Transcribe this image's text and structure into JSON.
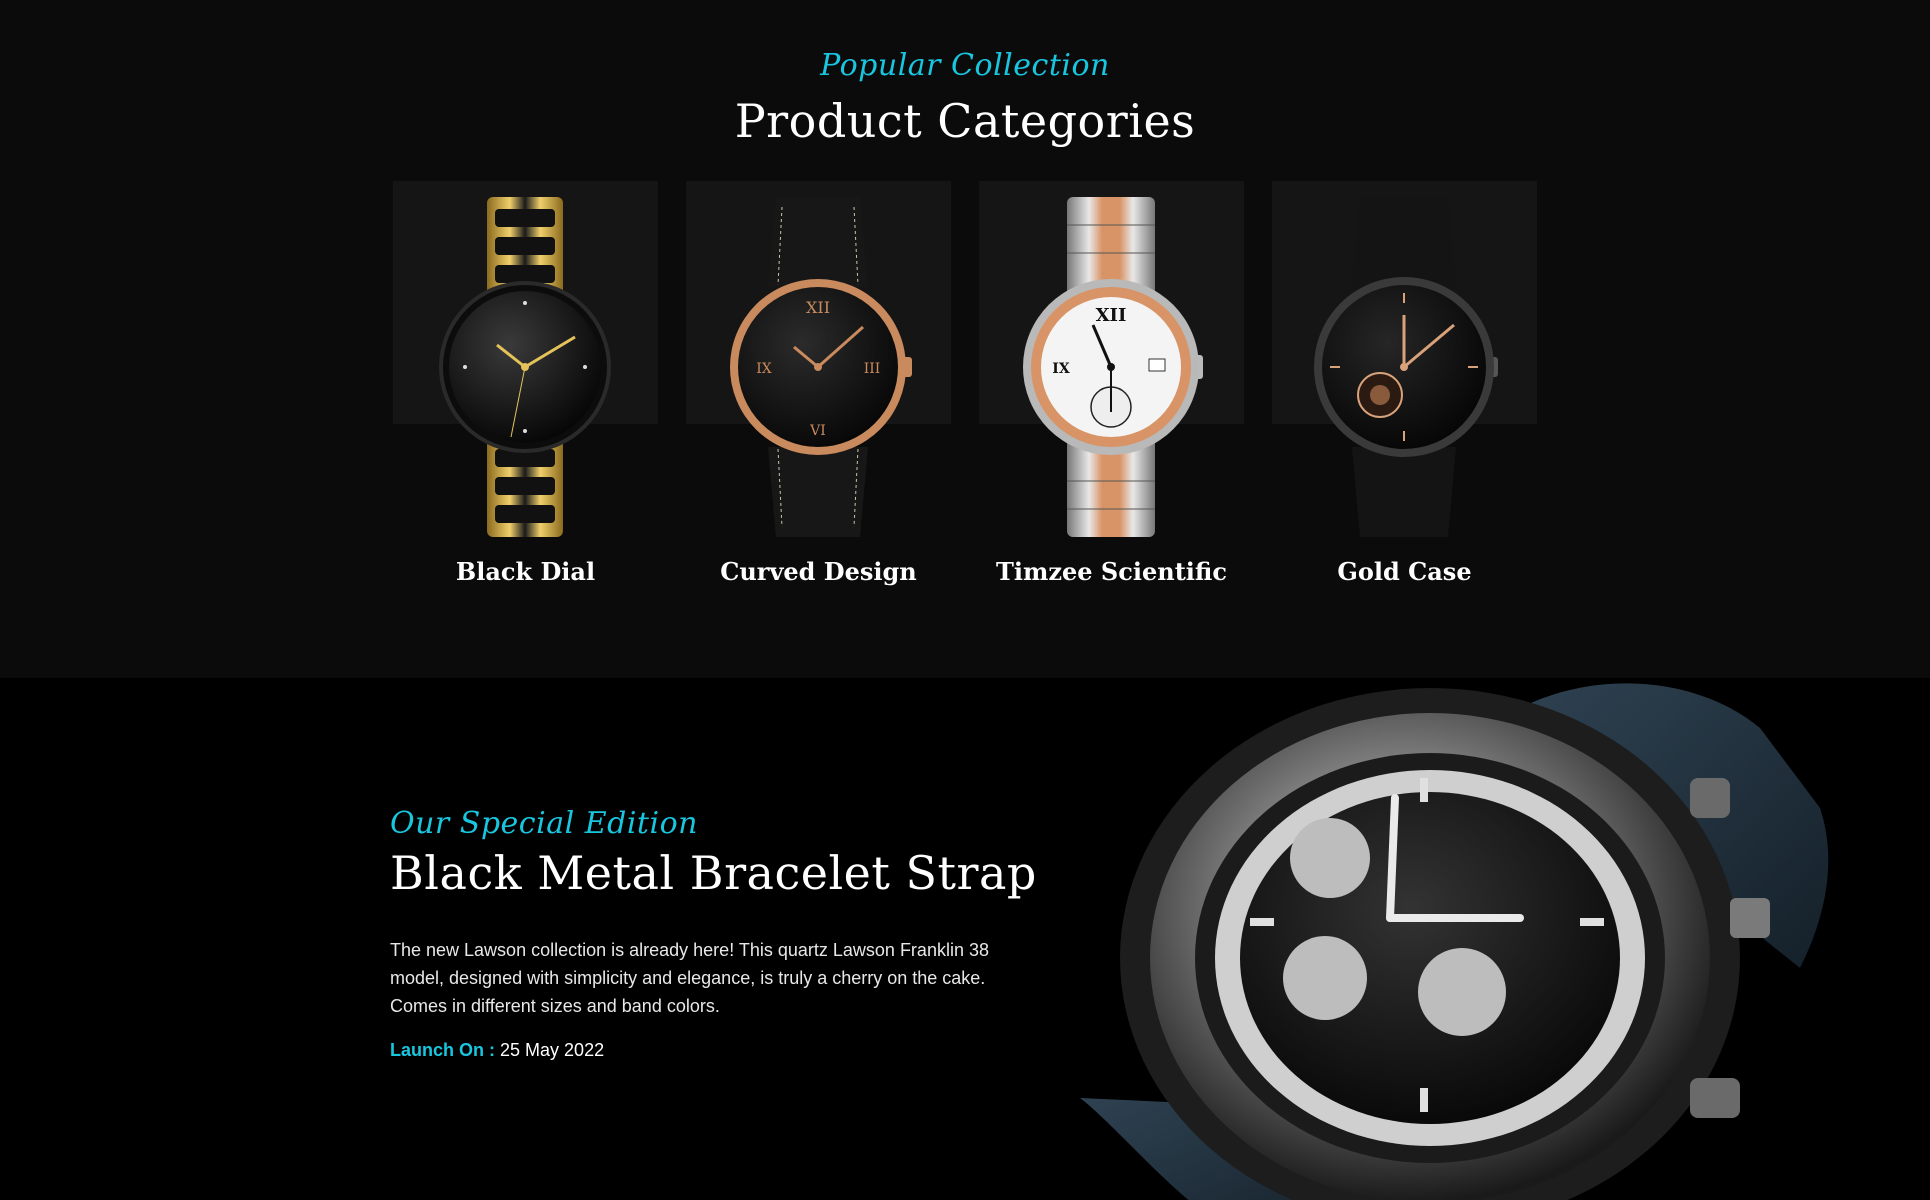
{
  "categories_section": {
    "subtitle": "Popular Collection",
    "title": "Product Categories",
    "items": [
      {
        "label": "Black Dial",
        "icon": "gold-black-ceramic-watch"
      },
      {
        "label": "Curved Design",
        "icon": "rose-gold-leather-watch"
      },
      {
        "label": "Timzee Scientific",
        "icon": "two-tone-chronograph-watch"
      },
      {
        "label": "Gold Case",
        "icon": "skeleton-leather-watch"
      }
    ]
  },
  "edition_section": {
    "subtitle": "Our Special Edition",
    "title": "Black Metal Bracelet Strap",
    "description": "The new Lawson collection is already here! This quartz Lawson Franklin 38 model, designed with simplicity and elegance, is truly a cherry on the cake. Comes in different sizes and band colors.",
    "launch_label": "Launch On :",
    "launch_date": "25 May 2022",
    "image": "chronograph-watch-leather-strap"
  },
  "colors": {
    "accent": "#19c6e0",
    "top_background": "#0b0b0b",
    "bottom_background": "#000000",
    "card_background": "#151515"
  }
}
